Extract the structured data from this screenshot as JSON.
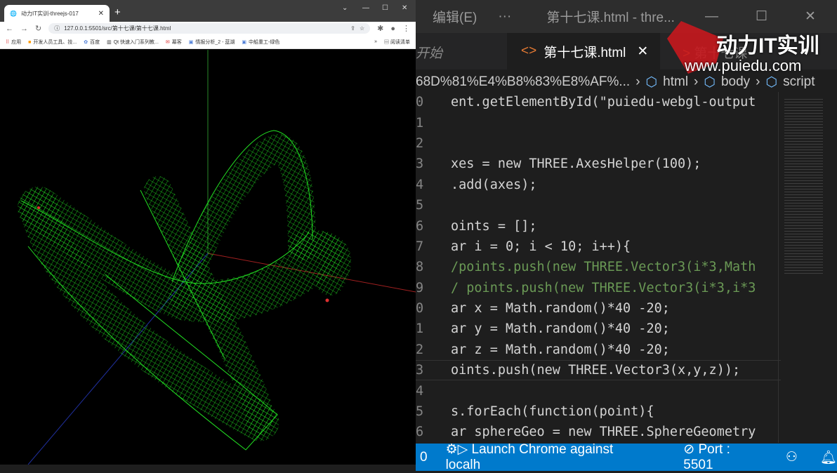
{
  "browser": {
    "tab_title": "动力IT实训-threejs-017",
    "url": "127.0.0.1:5501/src/第十七课/第十七课.html",
    "bookmarks": [
      "应用",
      "开发人员工具、技...",
      "百度",
      "Qt 快速入门系列教...",
      "幕客",
      "情报分析_2 - 蓝湖",
      "中船重工-绿色"
    ],
    "reading_list": "阅读清单",
    "more": "»"
  },
  "editor": {
    "menu": "编辑(E)",
    "more": "···",
    "window_title": "第十七课.html - thre...",
    "tabs": {
      "left": "开始",
      "active": "第十七课.html",
      "next": "第十七课 - "
    },
    "breadcrumb": {
      "path": "68D%81%E4%B8%83%E8%AF%...",
      "items": [
        "html",
        "body",
        "script"
      ]
    },
    "line_numbers": [
      "0",
      "1",
      "2",
      "3",
      "4",
      "5",
      "6",
      "7",
      "8",
      "9",
      "0",
      "1",
      "2",
      "3",
      "4",
      "5",
      "6"
    ],
    "code": [
      "ent.getElementById(\"puiedu-webgl-output",
      "",
      "",
      "xes = new THREE.AxesHelper(100);",
      ".add(axes);",
      "",
      "oints = [];",
      "ar i = 0; i < 10; i++){",
      "/points.push(new THREE.Vector3(i*3,Math",
      "/ points.push(new THREE.Vector3(i*3,i*3",
      "ar x = Math.random()*40 -20;",
      "ar y = Math.random()*40 -20;",
      "ar z = Math.random()*40 -20;",
      "oints.push(new THREE.Vector3(x,y,z));",
      "",
      "s.forEach(function(point){",
      "ar sphereGeo = new THREE.SphereGeometry"
    ]
  },
  "status": {
    "count": "0",
    "launch": "Launch Chrome against localh",
    "port": "Port : 5501"
  },
  "watermark": {
    "brand": "动力IT实训",
    "site": "www.puiedu.com"
  }
}
